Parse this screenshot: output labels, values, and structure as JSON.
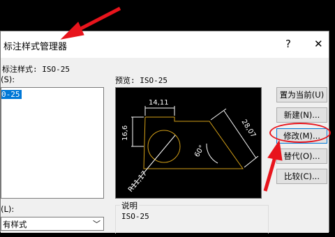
{
  "dialog": {
    "title": "标注样式管理器",
    "help_icon": "?",
    "close_icon": "✕"
  },
  "current_style": {
    "label": "标注样式: ISO-25"
  },
  "styles_list": {
    "label": "(S):",
    "items": [
      "0-25"
    ],
    "selected_index": 0
  },
  "list_filter": {
    "label": "(L):",
    "value": "有样式"
  },
  "preview": {
    "label": "预览: ISO-25",
    "dims": {
      "top": "14,11",
      "left": "16,6",
      "diagonal": "28,07",
      "angle": "60°",
      "radius": "R11,17"
    },
    "colors": {
      "dim_line": "#ffffff",
      "geometry": "#d4a017",
      "background": "#000000"
    }
  },
  "description": {
    "label": "说明",
    "value": "ISO-25"
  },
  "buttons": {
    "set_current": "置为当前(U)",
    "new": "新建(N)...",
    "modify": "修改(M)...",
    "override": "替代(O)...",
    "compare": "比较(C)..."
  },
  "annotation_color": "#e8141c"
}
